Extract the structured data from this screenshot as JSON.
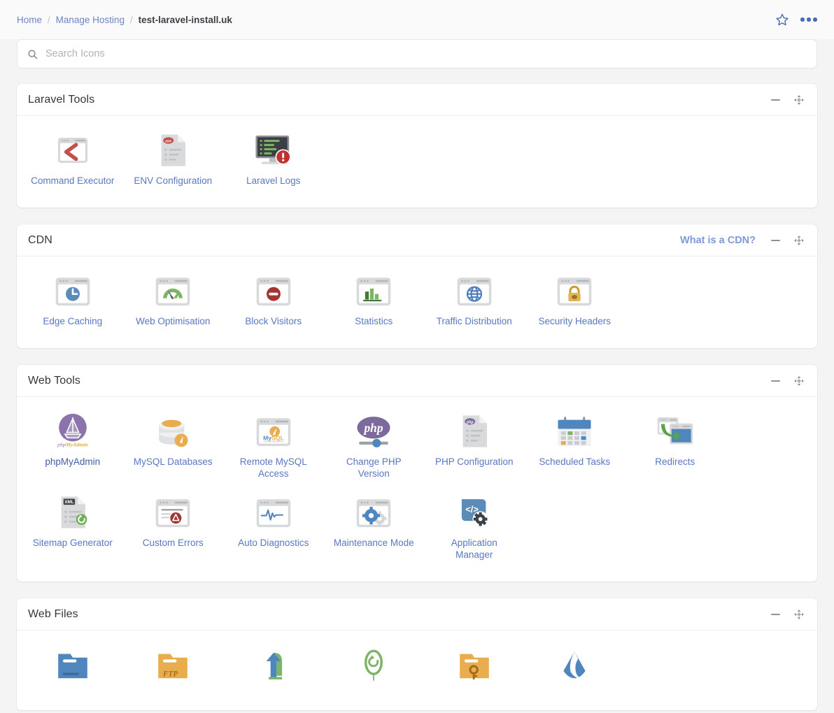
{
  "breadcrumb": {
    "items": [
      {
        "label": "Home",
        "type": "link"
      },
      {
        "label": "Manage Hosting",
        "type": "link"
      },
      {
        "label": "test-laravel-install.uk",
        "type": "current"
      }
    ],
    "separator": "/"
  },
  "topbar": {
    "favourite_icon": "star-outline-icon",
    "more_icon": "more-options-icon",
    "accent": "#4c6ab3"
  },
  "search": {
    "placeholder": "Search Icons",
    "value": "",
    "icon": "search-icon"
  },
  "section_controls": {
    "minimize_icon": "minus-icon",
    "move_icon": "move-arrows-icon"
  },
  "sections": [
    {
      "title": "Laravel Tools",
      "link": null,
      "tiles": [
        {
          "label": "Command Executor",
          "icon": "command-executor-icon"
        },
        {
          "label": "ENV Configuration",
          "icon": "env-configuration-icon"
        },
        {
          "label": "Laravel Logs",
          "icon": "laravel-logs-icon"
        }
      ]
    },
    {
      "title": "CDN",
      "link": "What is a CDN?",
      "tiles": [
        {
          "label": "Edge Caching",
          "icon": "edge-caching-icon"
        },
        {
          "label": "Web Optimisation",
          "icon": "web-optimisation-icon"
        },
        {
          "label": "Block Visitors",
          "icon": "block-visitors-icon"
        },
        {
          "label": "Statistics",
          "icon": "statistics-icon"
        },
        {
          "label": "Traffic Distribution",
          "icon": "traffic-distribution-icon"
        },
        {
          "label": "Security Headers",
          "icon": "security-headers-icon"
        }
      ]
    },
    {
      "title": "Web Tools",
      "link": null,
      "tiles": [
        {
          "label": "phpMyAdmin",
          "icon": "phpmyadmin-icon"
        },
        {
          "label": "MySQL Databases",
          "icon": "mysql-databases-icon"
        },
        {
          "label": "Remote MySQL Access",
          "icon": "remote-mysql-access-icon"
        },
        {
          "label": "Change PHP Version",
          "icon": "change-php-version-icon"
        },
        {
          "label": "PHP Configuration",
          "icon": "php-configuration-icon"
        },
        {
          "label": "Scheduled Tasks",
          "icon": "scheduled-tasks-icon"
        },
        {
          "label": "Redirects",
          "icon": "redirects-icon"
        },
        {
          "label": "Sitemap Generator",
          "icon": "sitemap-generator-icon"
        },
        {
          "label": "Custom Errors",
          "icon": "custom-errors-icon"
        },
        {
          "label": "Auto Diagnostics",
          "icon": "auto-diagnostics-icon"
        },
        {
          "label": "Maintenance Mode",
          "icon": "maintenance-mode-icon"
        },
        {
          "label": "Application Manager",
          "icon": "application-manager-icon"
        }
      ]
    },
    {
      "title": "Web Files",
      "link": null,
      "tiles": [
        {
          "label": "",
          "icon": "file-manager-icon"
        },
        {
          "label": "",
          "icon": "ftp-accounts-icon"
        },
        {
          "label": "",
          "icon": "upload-icon"
        },
        {
          "label": "",
          "icon": "backups-icon"
        },
        {
          "label": "",
          "icon": "protected-folder-icon"
        },
        {
          "label": "",
          "icon": "git-icon"
        }
      ]
    }
  ],
  "colors": {
    "page_background": "#f4f4f4",
    "panel_background": "#ffffff",
    "link_blue": "#5878c0",
    "accent_blue": "#4c6ab3",
    "icon_blue": "#5b8cb8",
    "icon_green": "#7cb563",
    "icon_red": "#c8433c",
    "icon_orange": "#eab14f",
    "icon_purple": "#8d73ab",
    "muted_gray": "#8d9199"
  }
}
